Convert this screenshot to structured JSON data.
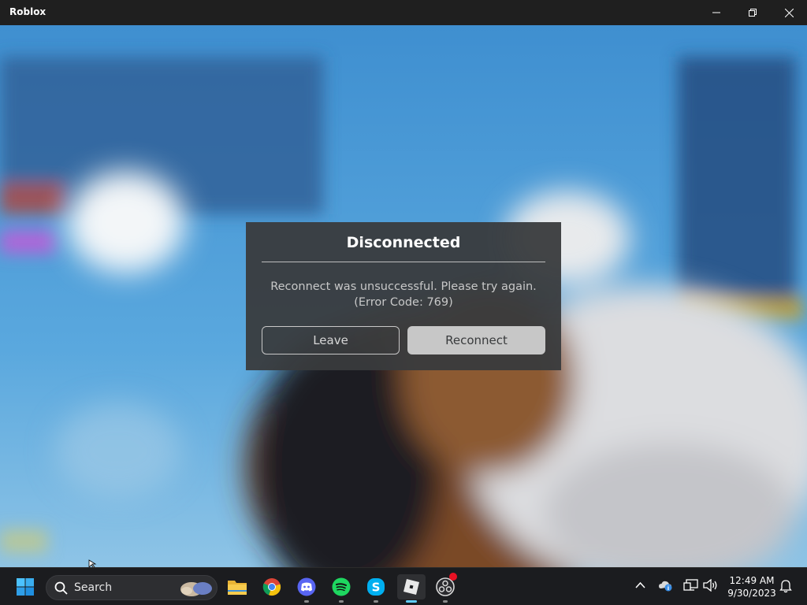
{
  "window": {
    "title": "Roblox",
    "controls": [
      "minimize-icon",
      "restore-icon",
      "close-icon"
    ]
  },
  "dialog": {
    "title": "Disconnected",
    "message_line1": "Reconnect was unsuccessful. Please try again.",
    "message_line2": "(Error Code: 769)",
    "leave_label": "Leave",
    "reconnect_label": "Reconnect"
  },
  "taskbar": {
    "search_label": "Search",
    "apps": [
      {
        "name": "start-icon"
      },
      {
        "name": "file-explorer-icon"
      },
      {
        "name": "chrome-icon"
      },
      {
        "name": "discord-icon"
      },
      {
        "name": "spotify-icon"
      },
      {
        "name": "skype-icon"
      },
      {
        "name": "roblox-icon",
        "active": true
      },
      {
        "name": "obs-icon",
        "badge": true
      }
    ],
    "tray_icons": [
      "chevron-up-icon",
      "onedrive-icon",
      "network-icon",
      "volume-icon",
      "notification-bell-icon"
    ],
    "time": "12:49 AM",
    "date": "9/30/2023"
  },
  "colors": {
    "titlebar": "#1f1f1f",
    "dialog_bg": "#393b3d",
    "reconnect_bg": "#c7c7c7",
    "taskbar": "#1b1c1f",
    "accent": "#60cdff",
    "sky": "#4a9ad6"
  }
}
